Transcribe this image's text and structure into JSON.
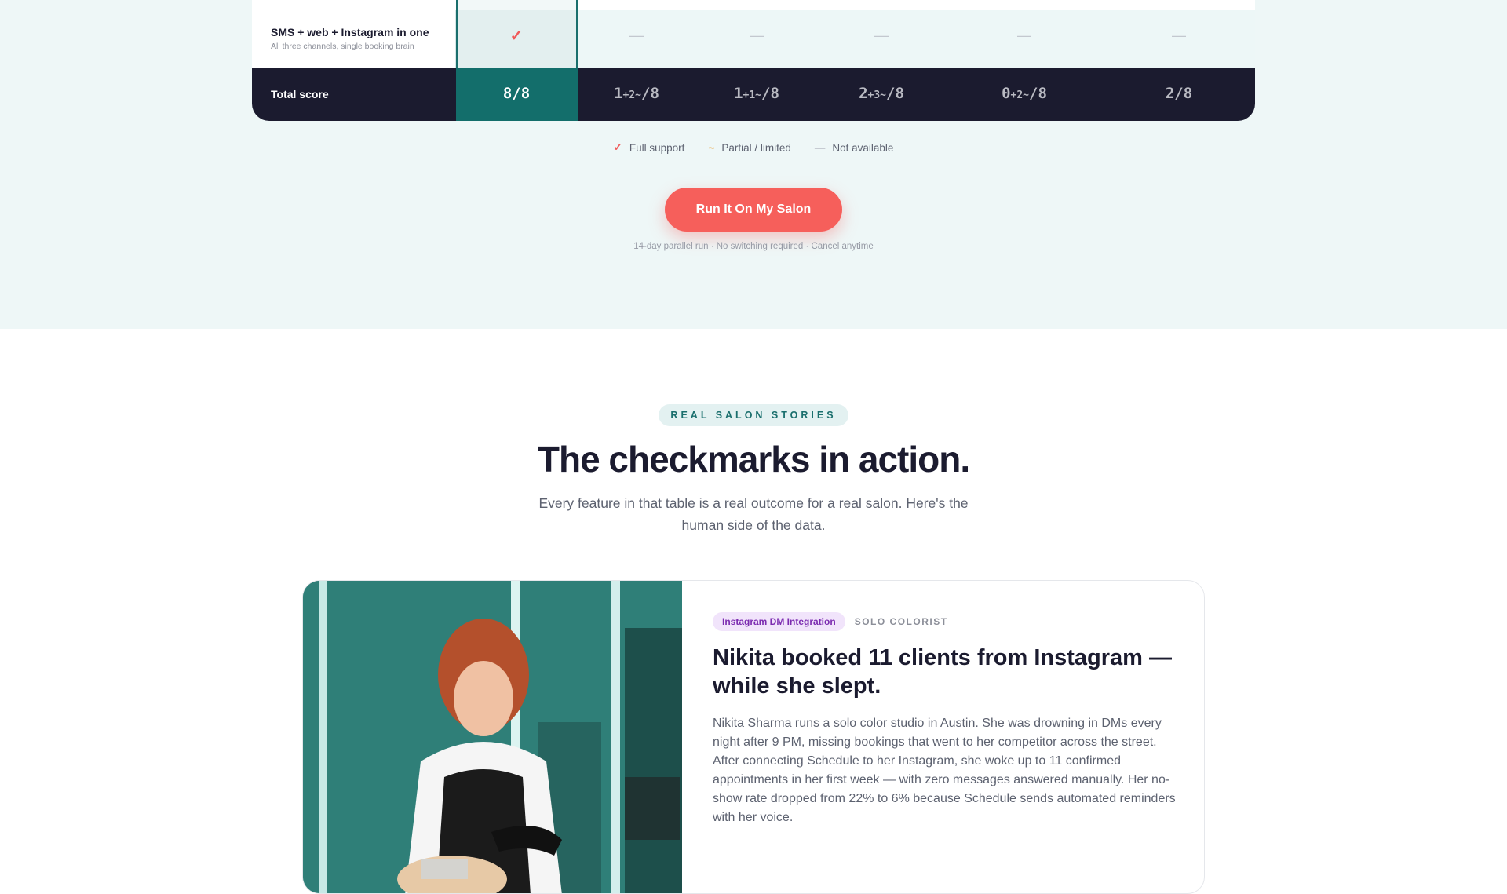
{
  "comparison": {
    "feature_row": {
      "title": "SMS + web + Instagram in one",
      "subtitle": "All three channels, single booking brain",
      "marks": [
        "✓",
        "—",
        "—",
        "—",
        "—",
        "—"
      ]
    },
    "total": {
      "label": "Total score",
      "scores": [
        {
          "main": "8/8",
          "full": "8",
          "partial": "",
          "suffix": "/8"
        },
        {
          "full": "1",
          "partial": "+2~",
          "suffix": "/8"
        },
        {
          "full": "1",
          "partial": "+1~",
          "suffix": "/8"
        },
        {
          "full": "2",
          "partial": "+3~",
          "suffix": "/8"
        },
        {
          "full": "0",
          "partial": "+2~",
          "suffix": "/8"
        },
        {
          "full": "2",
          "partial": "",
          "suffix": "/8"
        }
      ]
    },
    "legend": {
      "full_icon": "✓",
      "full_label": "Full support",
      "partial_icon": "~",
      "partial_label": "Partial / limited",
      "na_icon": "—",
      "na_label": "Not available"
    },
    "cta": {
      "label": "Run It On My Salon",
      "note": "14-day parallel run · No switching required · Cancel anytime"
    }
  },
  "stories": {
    "eyebrow": "REAL SALON STORIES",
    "heading": "The checkmarks in action.",
    "subheading": "Every feature in that table is a real outcome for a real salon. Here's the human side of the data.",
    "card": {
      "tag": "Instagram DM Integration",
      "meta": "SOLO COLORIST",
      "title": "Nikita booked 11 clients from Instagram — while she slept.",
      "text": "Nikita Sharma runs a solo color studio in Austin. She was drowning in DMs every night after 9 PM, missing bookings that went to her competitor across the street. After connecting Schedule to her Instagram, she woke up to 11 confirmed appointments in her first week — with zero messages answered manually. Her no-show rate dropped from 22% to 6% because Schedule sends automated reminders with her voice."
    }
  },
  "colors": {
    "accent_coral": "#f65f5b",
    "brand_teal": "#136e6b",
    "dark_navy": "#1b1b2f",
    "section_tint": "#eef7f7",
    "tag_purple": "#7b2bb0"
  }
}
